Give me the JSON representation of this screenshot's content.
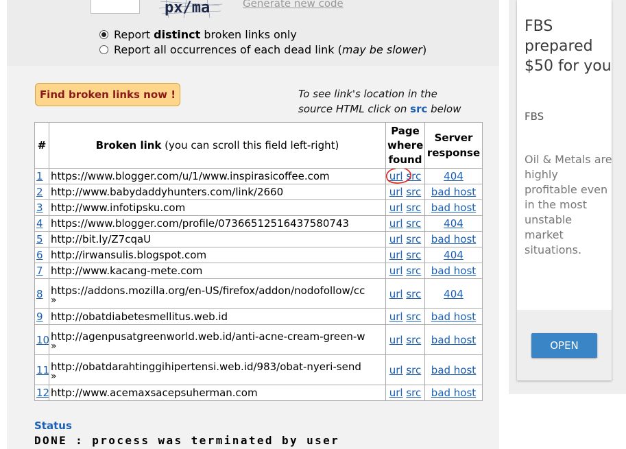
{
  "captcha": {
    "text": "px/ma",
    "generate_label": "Generate new code"
  },
  "options": {
    "distinct": {
      "pre": "Report ",
      "bold": "distinct",
      "post": " broken links only",
      "checked": true
    },
    "all": {
      "pre": "Report all occurrences of each dead link (",
      "italic": "may be slower",
      "post": ")",
      "checked": false
    }
  },
  "find_button": "Find broken links now !",
  "hint": {
    "line1": "To see link's location in the",
    "line2_pre": "source HTML click on ",
    "line2_src": "src",
    "line2_post": " below"
  },
  "table": {
    "headers": {
      "num": "#",
      "broken_bold": "Broken link",
      "broken_normal": " (you can scroll this field left-right)",
      "page_l1": "Page",
      "page_l2": "where",
      "page_l3": "found",
      "server_l1": "Server",
      "server_l2": "response"
    },
    "url_label": "url",
    "src_label": "src",
    "rows": [
      {
        "n": "1",
        "link": "https://www.blogger.com/u/1/www.inspirasicoffee.com",
        "resp": "404",
        "wrap": false
      },
      {
        "n": "2",
        "link": "http://www.babydaddyhunters.com/link/2660",
        "resp": "bad host",
        "wrap": false
      },
      {
        "n": "3",
        "link": "http://www.infotipsku.com",
        "resp": "bad host",
        "wrap": false
      },
      {
        "n": "4",
        "link": "https://www.blogger.com/profile/07366512516437580743",
        "resp": "404",
        "wrap": false
      },
      {
        "n": "5",
        "link": "http://bit.ly/Z7cqaU",
        "resp": "bad host",
        "wrap": false
      },
      {
        "n": "6",
        "link": "http://irwansulis.blogspot.com",
        "resp": "404",
        "wrap": false
      },
      {
        "n": "7",
        "link": "http://www.kacang-mete.com",
        "resp": "bad host",
        "wrap": false
      },
      {
        "n": "8",
        "link": "https://addons.mozilla.org/en-US/firefox/addon/nodofollow/cc",
        "resp": "404",
        "wrap": true
      },
      {
        "n": "9",
        "link": "http://obatdiabetesmellitus.web.id",
        "resp": "bad host",
        "wrap": false
      },
      {
        "n": "10",
        "link": "http://agenpusatgreenworld.web.id/anti-acne-cream-green-w",
        "resp": "bad host",
        "wrap": true
      },
      {
        "n": "11",
        "link": "http://obatdarahtinggihipertensi.web.id/983/obat-nyeri-send",
        "resp": "bad host",
        "wrap": true
      },
      {
        "n": "12",
        "link": "http://www.acemaxsacepsuherman.com",
        "resp": "bad host",
        "wrap": false
      }
    ],
    "scroll_marker": "»"
  },
  "status": {
    "label": "Status",
    "text": "DONE : process was terminated by user"
  },
  "ad": {
    "headline": "FBS prepared $50 for you",
    "brand": "FBS",
    "body": "Oil & Metals are highly profitable even in the most unstable market situations.",
    "cta": "OPEN"
  },
  "colors": {
    "link": "#1a5fb4",
    "button_bg": "#fdd68c",
    "button_text": "#8b1a1a",
    "ad_button": "#3a85c6",
    "highlight_circle": "#e0201c"
  }
}
